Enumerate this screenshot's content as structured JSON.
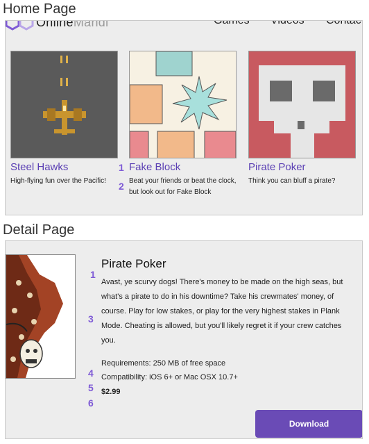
{
  "sections": {
    "home": "Home Page",
    "detail": "Detail Page"
  },
  "logo": {
    "text_main": "Online",
    "text_dim": "Mandi"
  },
  "nav": [
    "Games",
    "Videos",
    "Contact"
  ],
  "cards": [
    {
      "title": "Steel Hawks",
      "description": "High-flying fun over the Pacific!"
    },
    {
      "title": "Fake Block",
      "description": "Beat your friends or beat the clock, but look out for Fake Block"
    },
    {
      "title": "Pirate Poker",
      "description": "Think you can bluff a pirate?"
    }
  ],
  "home_numbers": [
    "1",
    "2"
  ],
  "detail": {
    "title": "Pirate Poker",
    "description": "Avast, ye scurvy dogs! There's money to be made on the high seas, but what's a pirate to do in his downtime? Take his crewmates' money, of course. Play for low stakes, or play for the very highest stakes in Plank Mode. Cheating is allowed, but you'll likely regret it if your crew catches you.",
    "requirements": "Requirements: 250 MB of free space",
    "compatibility": "Compatibility: iOS 6+ or Mac OSX 10.7+",
    "price": "$2.99",
    "download_label": "Download",
    "numbers": [
      "1",
      "3",
      "4",
      "5",
      "6"
    ]
  },
  "colors": {
    "accent": "#6a4bb6",
    "link": "#5b40b4",
    "annotation": "#7f5bd6",
    "panel_bg": "#ededed"
  },
  "icons": {
    "logo": "hexagon-logo-icon"
  }
}
